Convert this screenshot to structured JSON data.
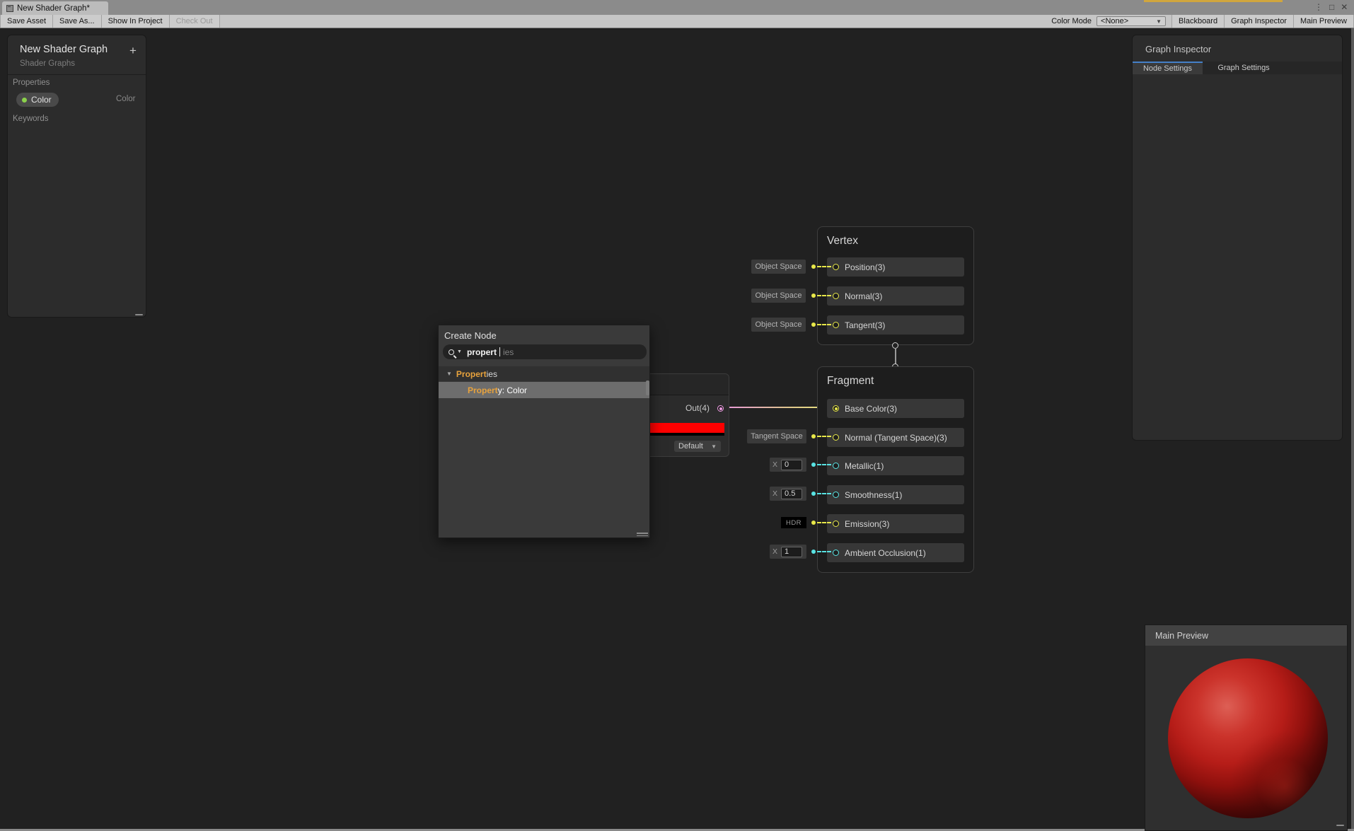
{
  "window": {
    "tab_title": "New Shader Graph*",
    "controls": {
      "menu": "⋮",
      "maximize": "□",
      "close": "✕"
    }
  },
  "toolbar": {
    "save_asset": "Save Asset",
    "save_as": "Save As...",
    "show_in_project": "Show In Project",
    "check_out": "Check Out",
    "color_mode_label": "Color Mode",
    "color_mode_value": "<None>",
    "color_mode_arrow": "▼",
    "blackboard": "Blackboard",
    "graph_inspector": "Graph Inspector",
    "main_preview": "Main Preview"
  },
  "blackboard": {
    "title": "New Shader Graph",
    "subtitle": "Shader Graphs",
    "add_button": "+",
    "properties_label": "Properties",
    "keywords_label": "Keywords",
    "property_pill": {
      "label": "Color",
      "type": "Color"
    }
  },
  "graph_inspector": {
    "title": "Graph Inspector",
    "tabs": [
      {
        "label": "Node Settings",
        "active": true
      },
      {
        "label": "Graph Settings",
        "active": false
      }
    ]
  },
  "create_node": {
    "title": "Create Node",
    "search_typed": "propert",
    "search_ghost": "ies",
    "dropdown_arrow": "▼",
    "section": {
      "expander": "▼",
      "match": "Propert",
      "rest": "ies"
    },
    "result": {
      "match": "Propert",
      "rest": "y: Color"
    }
  },
  "color_node": {
    "out_label": "Out(4)",
    "swatch_color": "#ff0000",
    "dropdown_value": "Default",
    "dropdown_arrow": "▼"
  },
  "vertex_node": {
    "title": "Vertex",
    "rows": [
      {
        "label": "Position(3)",
        "space": "Object Space"
      },
      {
        "label": "Normal(3)",
        "space": "Object Space"
      },
      {
        "label": "Tangent(3)",
        "space": "Object Space"
      }
    ]
  },
  "fragment_node": {
    "title": "Fragment",
    "rows": [
      {
        "label": "Base Color(3)"
      },
      {
        "label": "Normal (Tangent Space)(3)",
        "space": "Tangent Space"
      },
      {
        "label": "Metallic(1)",
        "x_label": "X",
        "value": "0"
      },
      {
        "label": "Smoothness(1)",
        "x_label": "X",
        "value": "0.5"
      },
      {
        "label": "Emission(3)",
        "hdr": "HDR"
      },
      {
        "label": "Ambient Occlusion(1)",
        "x_label": "X",
        "value": "1"
      }
    ]
  },
  "main_preview": {
    "title": "Main Preview"
  },
  "colors": {
    "port_vec3": "#e8e84a",
    "port_float": "#59e3e3",
    "port_vec4": "#ee9be2",
    "wire_start": "#e79ad7",
    "wire_end": "#e8e87a",
    "tab_accent": "#4580c8",
    "search_match_orange": "#e8a33d",
    "swatch_red": "#ff0000",
    "top_strip_yellow": "#d0a63e",
    "preview_sphere_red": "#b61d18"
  }
}
